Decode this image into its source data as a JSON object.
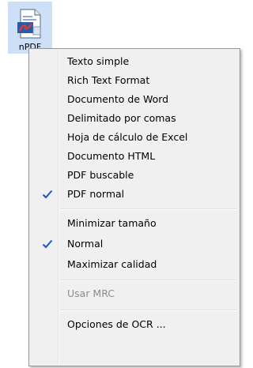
{
  "app": {
    "label": "nPDF"
  },
  "menu": {
    "items": [
      {
        "label": "Texto simple",
        "checked": false,
        "enabled": true
      },
      {
        "label": "Rich Text Format",
        "checked": false,
        "enabled": true
      },
      {
        "label": "Documento de Word",
        "checked": false,
        "enabled": true
      },
      {
        "label": "Delimitado por comas",
        "checked": false,
        "enabled": true
      },
      {
        "label": "Hoja de cálculo de Excel",
        "checked": false,
        "enabled": true
      },
      {
        "label": "Documento HTML",
        "checked": false,
        "enabled": true
      },
      {
        "label": "PDF buscable",
        "checked": false,
        "enabled": true
      },
      {
        "label": "PDF normal",
        "checked": true,
        "enabled": true
      },
      {
        "label": "Minimizar tamaño",
        "checked": false,
        "enabled": true
      },
      {
        "label": "Normal",
        "checked": true,
        "enabled": true
      },
      {
        "label": "Maximizar calidad",
        "checked": false,
        "enabled": true
      },
      {
        "label": "Usar MRC",
        "checked": false,
        "enabled": false
      },
      {
        "label": "Opciones de OCR ...",
        "checked": false,
        "enabled": true
      }
    ]
  },
  "colors": {
    "check": "#1a56c4",
    "tile": "#cde0f7"
  }
}
